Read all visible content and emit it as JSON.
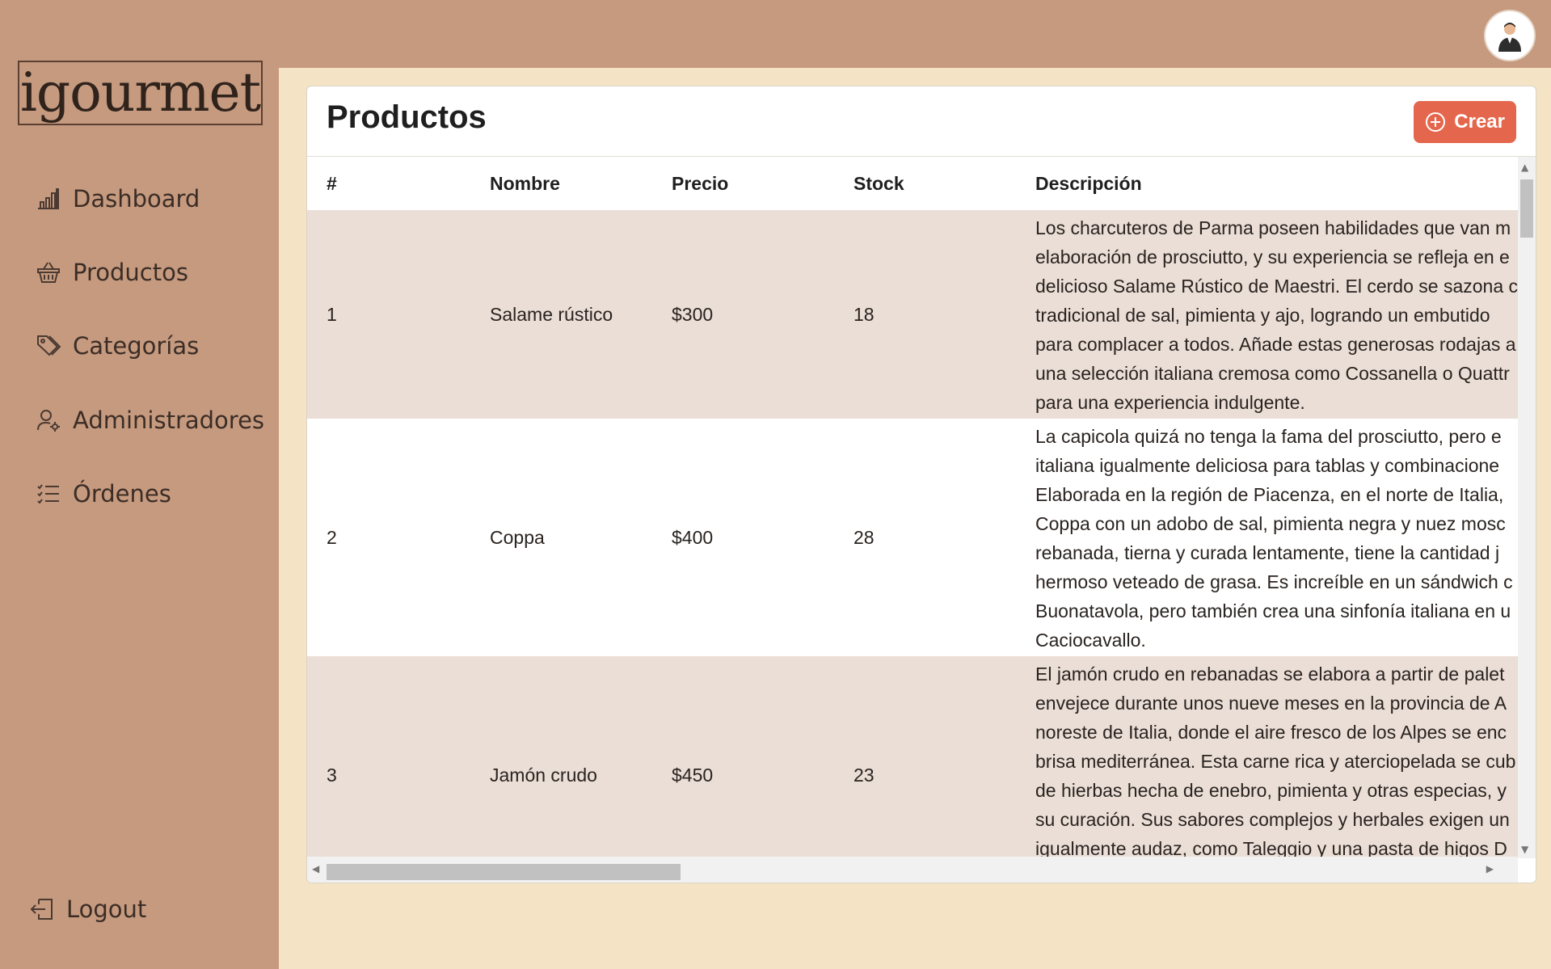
{
  "brand": {
    "logo_text": "igourmet"
  },
  "sidebar": {
    "items": [
      {
        "label": "Dashboard",
        "icon": "bar-chart-icon"
      },
      {
        "label": "Productos",
        "icon": "basket-icon"
      },
      {
        "label": "Categorías",
        "icon": "tags-icon"
      },
      {
        "label": "Administradores",
        "icon": "user-gear-icon"
      },
      {
        "label": "Órdenes",
        "icon": "list-check-icon"
      }
    ],
    "logout_label": "Logout"
  },
  "header": {
    "title": "Productos",
    "create_label": "Crear"
  },
  "table": {
    "columns": [
      "#",
      "Nombre",
      "Precio",
      "Stock",
      "Descripción"
    ],
    "rows": [
      {
        "id": "1",
        "nombre": "Salame rústico",
        "precio": "$300",
        "stock": "18",
        "descripcion": "Los charcuteros de Parma poseen habilidades que van m\nelaboración de prosciutto, y su experiencia se refleja en e\ndelicioso Salame Rústico de Maestri. El cerdo se sazona c\ntradicional de sal, pimienta y ajo, logrando un embutido\npara complacer a todos. Añade estas generosas rodajas a\nuna selección italiana cremosa como Cossanella o Quattr\npara una experiencia indulgente."
      },
      {
        "id": "2",
        "nombre": "Coppa",
        "precio": "$400",
        "stock": "28",
        "descripcion": "La capicola quizá no tenga la fama del prosciutto, pero e\nitaliana igualmente deliciosa para tablas y combinacione\nElaborada en la región de Piacenza, en el norte de Italia,\nCoppa con un adobo de sal, pimienta negra y nuez mosc\nrebanada, tierna y curada lentamente, tiene la cantidad j\nhermoso veteado de grasa. Es increíble en un sándwich c\nBuonatavola, pero también crea una sinfonía italiana en u\nCaciocavallo."
      },
      {
        "id": "3",
        "nombre": "Jamón crudo",
        "precio": "$450",
        "stock": "23",
        "descripcion": "El jamón crudo en rebanadas se elabora a partir de palet\nenvejece durante unos nueve meses en la provincia de A\nnoreste de Italia, donde el aire fresco de los Alpes se enc\nbrisa mediterránea. Esta carne rica y aterciopelada se cub\nde hierbas hecha de enebro, pimienta y otras especias, y\nsu curación. Sus sabores complejos y herbales exigen un\nigualmente audaz, como Taleggio y una pasta de higos D\nla Quinta y Picante de Manzaniana de..."
      }
    ]
  }
}
